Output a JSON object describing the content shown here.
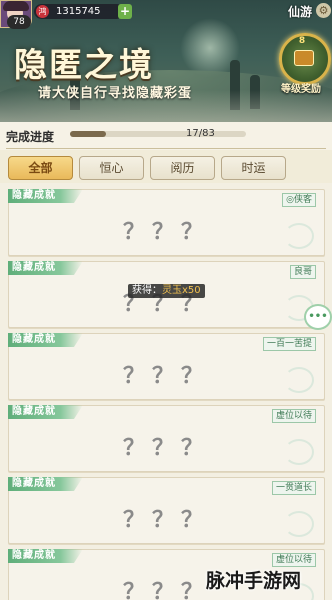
{
  "player": {
    "level": "78",
    "currency": "1315745",
    "add_label": "+",
    "currency_icon": "鸿"
  },
  "header": {
    "server": "仙游",
    "title": "隐匿之境",
    "subtitle": "请大侠自行寻找隐藏彩蛋",
    "reward_count": "8",
    "reward_label": "等级奖励"
  },
  "progress": {
    "label": "完成进度",
    "text": "17/83",
    "current": 17,
    "total": 83
  },
  "tabs": [
    {
      "label": "全部",
      "active": true
    },
    {
      "label": "恒心",
      "active": false
    },
    {
      "label": "阅历",
      "active": false
    },
    {
      "label": "时运",
      "active": false
    }
  ],
  "cards": [
    {
      "tag": "隐藏成就",
      "hint": "侠客",
      "hidden": "？？？"
    },
    {
      "tag": "隐藏成就",
      "hint": "良哥",
      "hidden": "？？？"
    },
    {
      "tag": "隐藏成就",
      "hint": "一百一苦提",
      "hidden": "？？？"
    },
    {
      "tag": "隐藏成就",
      "hint": "虚位以待",
      "hidden": "？？？"
    },
    {
      "tag": "隐藏成就",
      "hint": "一贯道长",
      "hidden": "？？？"
    },
    {
      "tag": "隐藏成就",
      "hint": "虚位以待",
      "hidden": "？？？"
    }
  ],
  "tooltip": {
    "prefix": "获得：",
    "item": "灵玉x50"
  },
  "chat_icon": "chat-bubble-icon",
  "watermark": "脉冲手游网",
  "colors": {
    "accent_green": "#5fae7a",
    "tab_active": "#e9b95a",
    "progress": "#7b6a4d"
  }
}
